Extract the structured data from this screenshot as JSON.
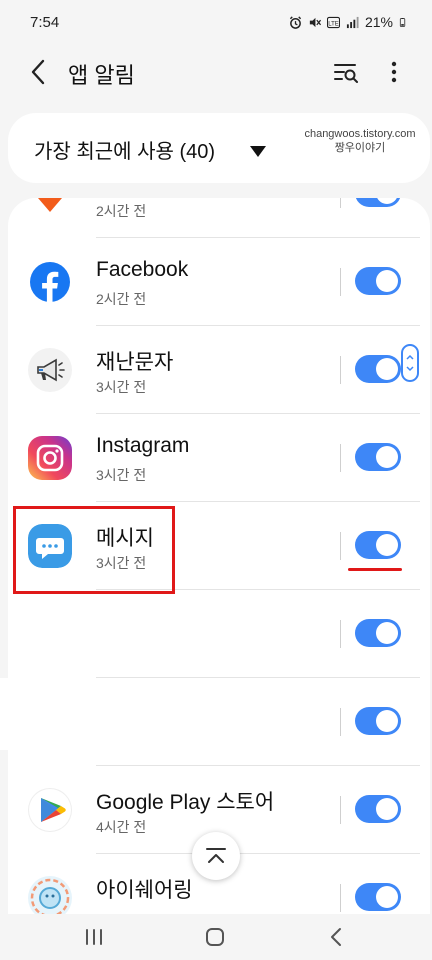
{
  "status_bar": {
    "time": "7:54",
    "battery": "21%",
    "icons": [
      "alarm-icon",
      "mute-icon",
      "volte-icon",
      "signal-icon",
      "battery-icon"
    ]
  },
  "header": {
    "title": "앱 알림",
    "back_icon": "back-arrow-icon",
    "filter_icon": "filter-search-icon",
    "more_icon": "more-vert-icon"
  },
  "sort": {
    "label": "가장 최근에 사용 (40)",
    "dropdown_icon": "caret-down-icon"
  },
  "watermark": {
    "line1": "changwoos.tistory.com",
    "line2": "짱우이야기"
  },
  "apps": [
    {
      "name": "",
      "time": "2시간 전",
      "enabled": true
    },
    {
      "name": "Facebook",
      "time": "2시간 전",
      "enabled": true,
      "icon": "facebook-icon"
    },
    {
      "name": "재난문자",
      "time": "3시간 전",
      "enabled": true,
      "icon": "megaphone-icon"
    },
    {
      "name": "Instagram",
      "time": "3시간 전",
      "enabled": true,
      "icon": "instagram-icon"
    },
    {
      "name": "메시지",
      "time": "3시간 전",
      "enabled": true,
      "icon": "messages-icon"
    },
    {
      "name": "",
      "time": "",
      "enabled": true
    },
    {
      "name": "",
      "time": "",
      "enabled": true
    },
    {
      "name": "Google Play 스토어",
      "time": "4시간 전",
      "enabled": true,
      "icon": "google-play-icon"
    },
    {
      "name": "아이쉐어링",
      "time": "",
      "enabled": true,
      "icon": "isharing-icon"
    }
  ],
  "colors": {
    "accent": "#3e87f7",
    "highlight": "#e01818",
    "background": "#f5f5f5"
  },
  "nav": {
    "recents_icon": "recents-icon",
    "home_icon": "home-icon",
    "back_icon": "nav-back-icon"
  }
}
